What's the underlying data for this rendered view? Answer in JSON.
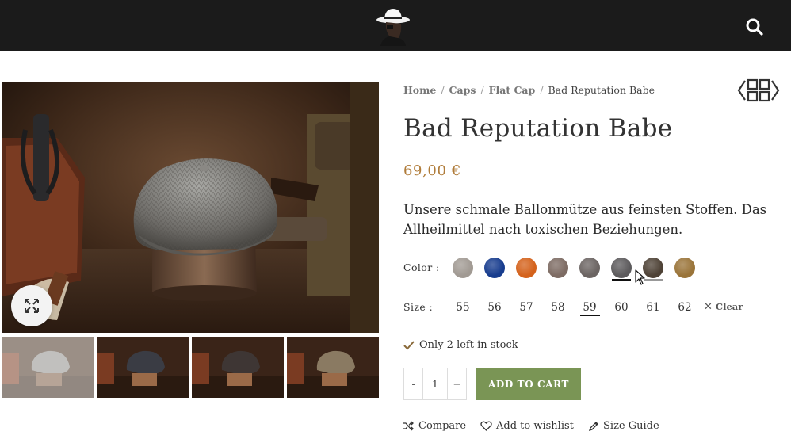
{
  "header": {
    "logo_icon": "hat-man-logo-icon",
    "search_icon": "search-icon"
  },
  "gallery": {
    "zoom_icon": "expand-icon",
    "thumbnail_count": 4
  },
  "breadcrumb": [
    {
      "label": "Home"
    },
    {
      "label": "Caps"
    },
    {
      "label": "Flat Cap"
    },
    {
      "label": "Bad Reputation Babe"
    }
  ],
  "product": {
    "title": "Bad Reputation Babe",
    "price": "69,00 €",
    "description": "Unsere schmale Ballonmütze aus feinsten Stoffen. Das Allheilmittel nach toxischen Beziehungen.",
    "stock": "Only 2 left in stock"
  },
  "color": {
    "label": "Color :",
    "swatches": [
      "#a19a93",
      "#173c8e",
      "#d4621c",
      "#7d6b63",
      "#6b6462",
      "#5c5a5c",
      "#4e4236",
      "#9a7439"
    ],
    "selected_index": 5,
    "hovered_index": 6
  },
  "size": {
    "label": "Size :",
    "options": [
      "55",
      "56",
      "57",
      "58",
      "59",
      "60",
      "61",
      "62"
    ],
    "selected": "59",
    "clear_label": "Clear"
  },
  "cart": {
    "minus": "-",
    "quantity": "1",
    "plus": "+",
    "add_label": "ADD TO CART",
    "accent": "#7a9555"
  },
  "actions": {
    "compare": "Compare",
    "wishlist": "Add to wishlist",
    "size_guide": "Size Guide"
  },
  "colors": {
    "topbar": "#1b1b1b",
    "price": "#b07c3a"
  }
}
